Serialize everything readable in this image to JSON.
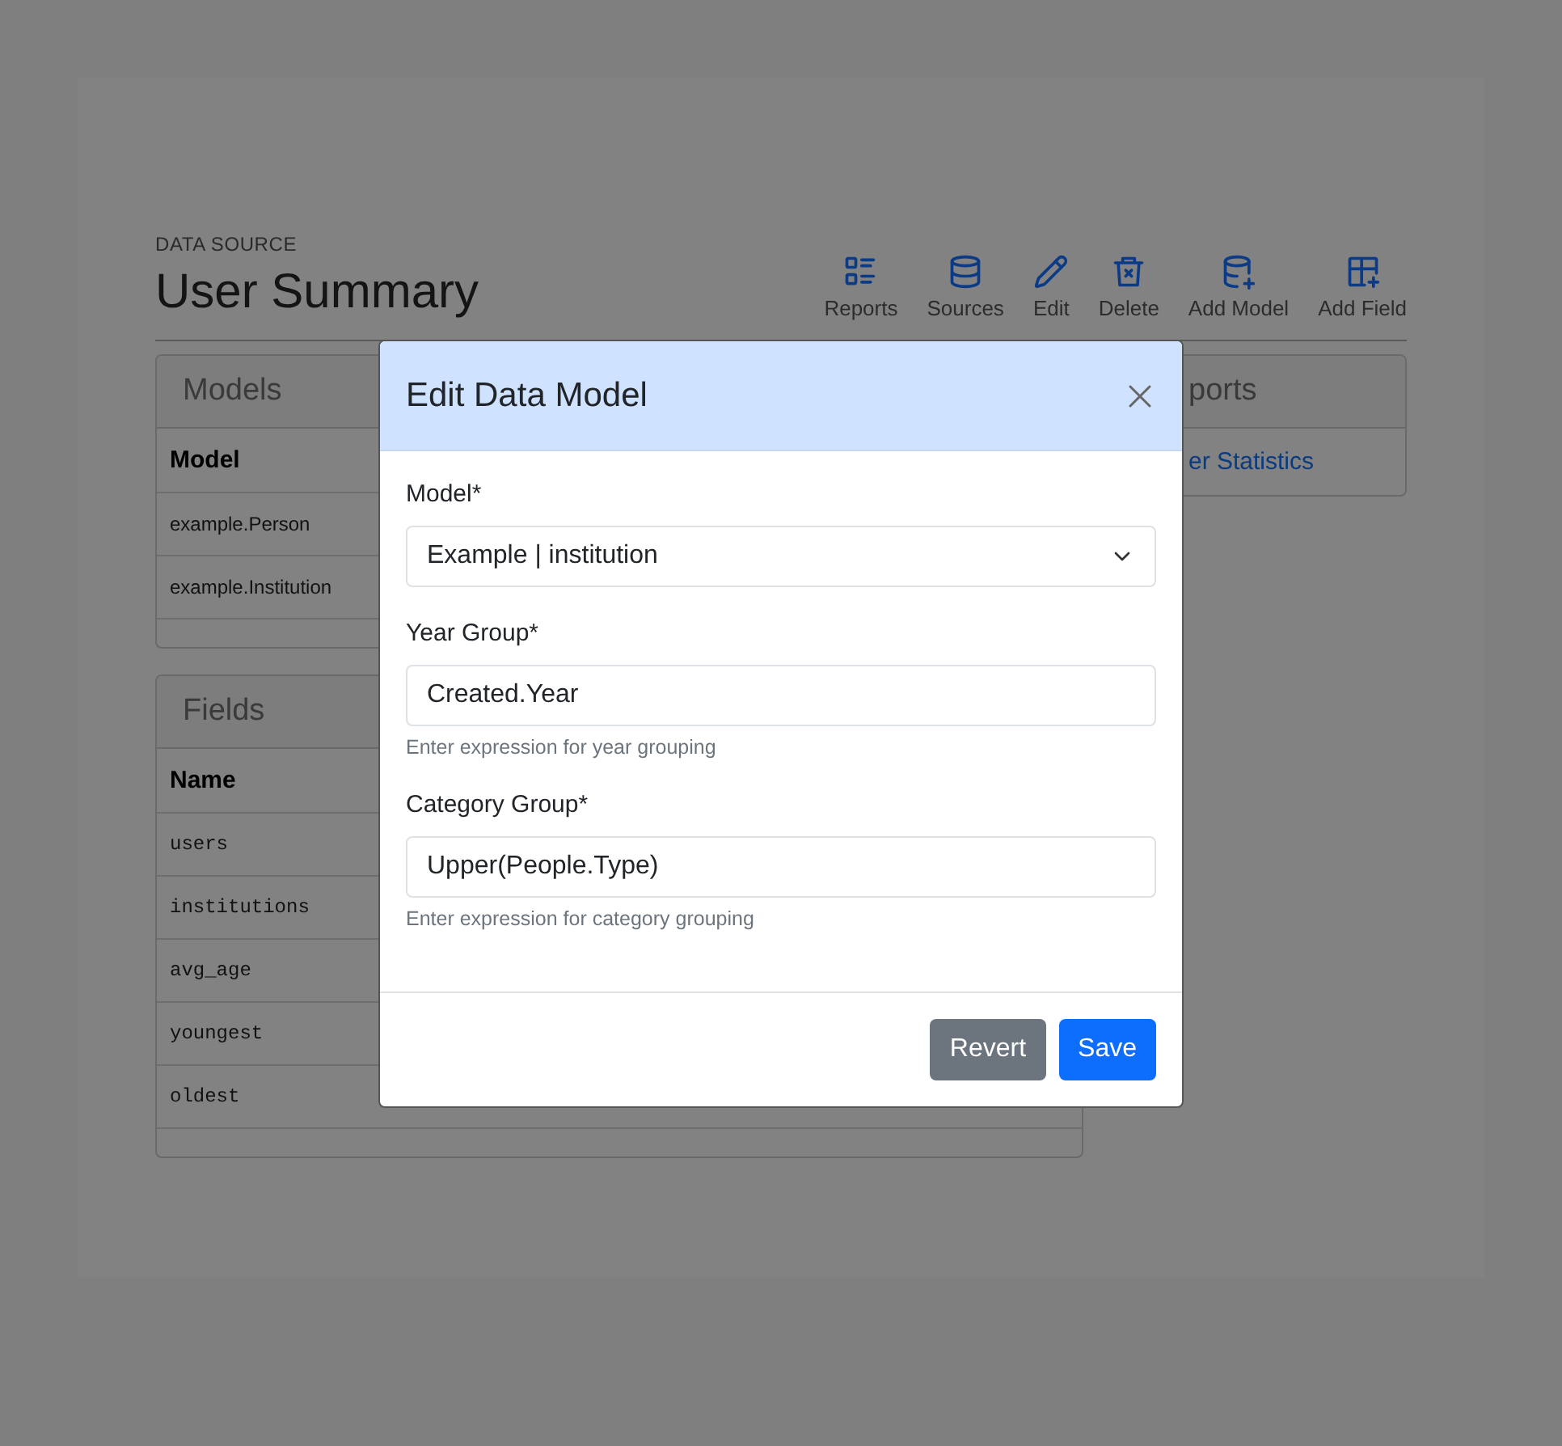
{
  "header": {
    "eyebrow": "DATA SOURCE",
    "title": "User Summary"
  },
  "toolbar": [
    {
      "label": "Reports",
      "kind": "list"
    },
    {
      "label": "Sources",
      "kind": "database"
    },
    {
      "label": "Edit",
      "kind": "pencil"
    },
    {
      "label": "Delete",
      "kind": "trash"
    },
    {
      "label": "Add Model",
      "kind": "database-plus"
    },
    {
      "label": "Add Field",
      "kind": "table-plus"
    }
  ],
  "models_card": {
    "title": "Models",
    "columns": [
      "Model"
    ],
    "rows": [
      [
        "example.Person"
      ],
      [
        "example.Institution"
      ]
    ]
  },
  "fields_card": {
    "title": "Fields",
    "columns": [
      "Name"
    ],
    "rows": [
      [
        "users"
      ],
      [
        "institutions"
      ],
      [
        "avg_age"
      ],
      [
        "youngest"
      ],
      [
        "oldest"
      ]
    ]
  },
  "reports_card": {
    "title": "ports",
    "links": [
      "er Statistics"
    ]
  },
  "modal": {
    "title": "Edit Data Model",
    "fields": [
      {
        "kind": "select",
        "label": "Model*",
        "value": "Example | institution"
      },
      {
        "kind": "text",
        "label": "Year Group*",
        "value": "Created.Year",
        "help": "Enter expression for year grouping"
      },
      {
        "kind": "text",
        "label": "Category Group*",
        "value": "Upper(People.Type)",
        "help": "Enter expression for category grouping"
      }
    ],
    "buttons": [
      {
        "label": "Revert",
        "kind": "secondary"
      },
      {
        "label": "Save",
        "kind": "primary"
      }
    ]
  }
}
